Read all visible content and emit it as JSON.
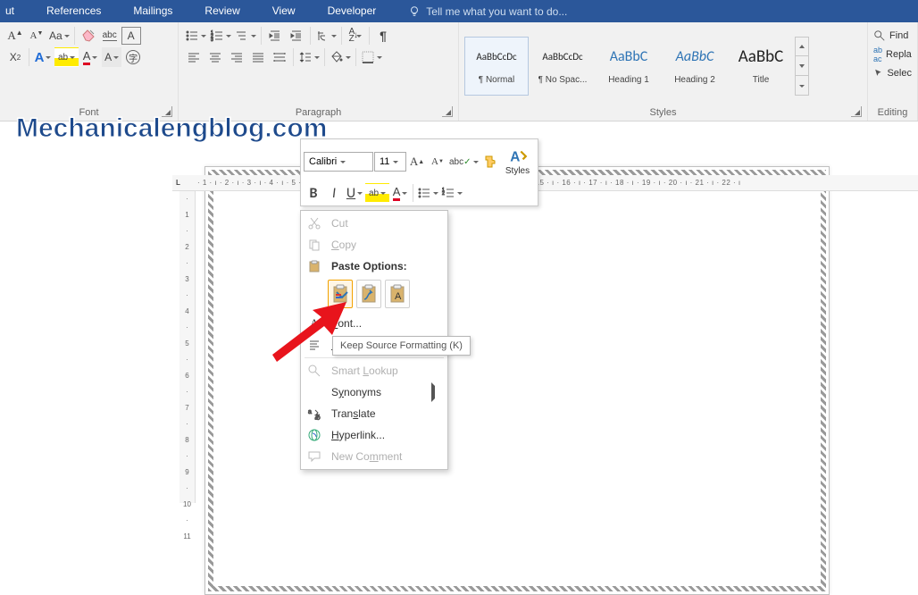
{
  "tabs": {
    "t0": "ut",
    "t1": "References",
    "t2": "Mailings",
    "t3": "Review",
    "t4": "View",
    "t5": "Developer"
  },
  "tellme": "Tell me what you want to do...",
  "groups": {
    "font": "Font",
    "paragraph": "Paragraph",
    "styles": "Styles",
    "editing": "Editing"
  },
  "styles": {
    "s0": {
      "preview": "AaBbCcDc",
      "name": "¶ Normal"
    },
    "s1": {
      "preview": "AaBbCcDc",
      "name": "¶ No Spac..."
    },
    "s2": {
      "preview": "AaBbC",
      "name": "Heading 1"
    },
    "s3": {
      "preview": "AaBbC",
      "name": "Heading 2"
    },
    "s4": {
      "preview": "AaBbC",
      "name": "Title"
    }
  },
  "editing": {
    "find": "Find",
    "replace": "Repla",
    "select": "Selec"
  },
  "watermark": "Mechanicalengblog.com",
  "mini": {
    "font": "Calibri",
    "size": "11",
    "b": "B",
    "i": "I",
    "u": "U",
    "a": "A",
    "styles": "Styles"
  },
  "ctx": {
    "cut": "Cut",
    "copy": "Copy",
    "paste_hdr": "Paste Options:",
    "font": "Font...",
    "para": "Paragraph...",
    "lookup": "Smart Lookup",
    "syn": "Synonyms",
    "trans": "Translate",
    "link": "Hyperlink...",
    "comment": "New Comment"
  },
  "tooltip": "Keep Source Formatting (K)",
  "ruler_h": "· 1 · ı · 2 · ı · 3 · ı · 4 · ı · 5 · ı · 6 · ı · 7 · ı · 8 · ı · 9 · ı · 10 · ı · 11 · ı · 12 · ı · 13 · ı · 14 · ı · 15 · ı · 16 · ı · 17 · ı · 18 · ı · 19 · ı · 20 · ı · 21 · ı · 22 · ı",
  "ruler_h_lbl": "L",
  "ruler_v": [
    "·",
    "1",
    "·",
    "2",
    "·",
    "3",
    "·",
    "4",
    "·",
    "5",
    "·",
    "6",
    "·",
    "7",
    "·",
    "8",
    "·",
    "9",
    "·",
    "10",
    "·",
    "11"
  ]
}
